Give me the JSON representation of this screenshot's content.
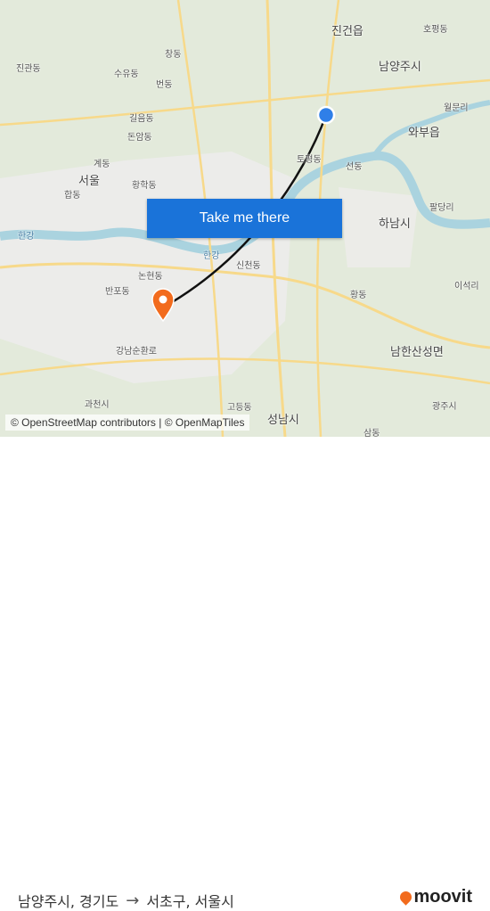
{
  "map": {
    "button_label": "Take me there",
    "attribution": "© OpenStreetMap contributors | © OpenMapTiles",
    "labels": [
      {
        "text": "진건읍",
        "big": true
      },
      {
        "text": "남양주시",
        "big": true
      },
      {
        "text": "와부읍",
        "big": true
      },
      {
        "text": "서울",
        "big": true
      },
      {
        "text": "하남시",
        "big": true
      },
      {
        "text": "남한산성면",
        "big": true
      },
      {
        "text": "성남시",
        "big": true
      },
      {
        "text": "한강",
        "big": false
      },
      {
        "text": "한강",
        "big": false
      },
      {
        "text": "수유동",
        "big": false
      },
      {
        "text": "번동",
        "big": false
      },
      {
        "text": "길음동",
        "big": false
      },
      {
        "text": "돈암동",
        "big": false
      },
      {
        "text": "계동",
        "big": false
      },
      {
        "text": "황학동",
        "big": false
      },
      {
        "text": "논현동",
        "big": false
      },
      {
        "text": "반포동",
        "big": false
      },
      {
        "text": "신천동",
        "big": false
      },
      {
        "text": "강남순환로",
        "big": false
      },
      {
        "text": "과천시",
        "big": false
      },
      {
        "text": "고등동",
        "big": false
      },
      {
        "text": "광주시",
        "big": false
      },
      {
        "text": "팔당리",
        "big": false
      },
      {
        "text": "이석리",
        "big": false
      },
      {
        "text": "호평동",
        "big": false
      },
      {
        "text": "월문리",
        "big": false
      },
      {
        "text": "선동",
        "big": false
      },
      {
        "text": "황동",
        "big": false
      },
      {
        "text": "삼동",
        "big": false
      },
      {
        "text": "진관동",
        "big": false
      },
      {
        "text": "창동",
        "big": false
      },
      {
        "text": "합동",
        "big": false
      },
      {
        "text": "토평동",
        "big": false
      }
    ],
    "origin_marker_color": "#2f7fe8",
    "destination_marker_color": "#f26b1d",
    "route_color": "#111111"
  },
  "footer": {
    "origin": "남양주시, 경기도",
    "arrow": "→",
    "destination": "서초구, 서울시",
    "logo": "moovit",
    "logo_color": "#f26b1d"
  }
}
